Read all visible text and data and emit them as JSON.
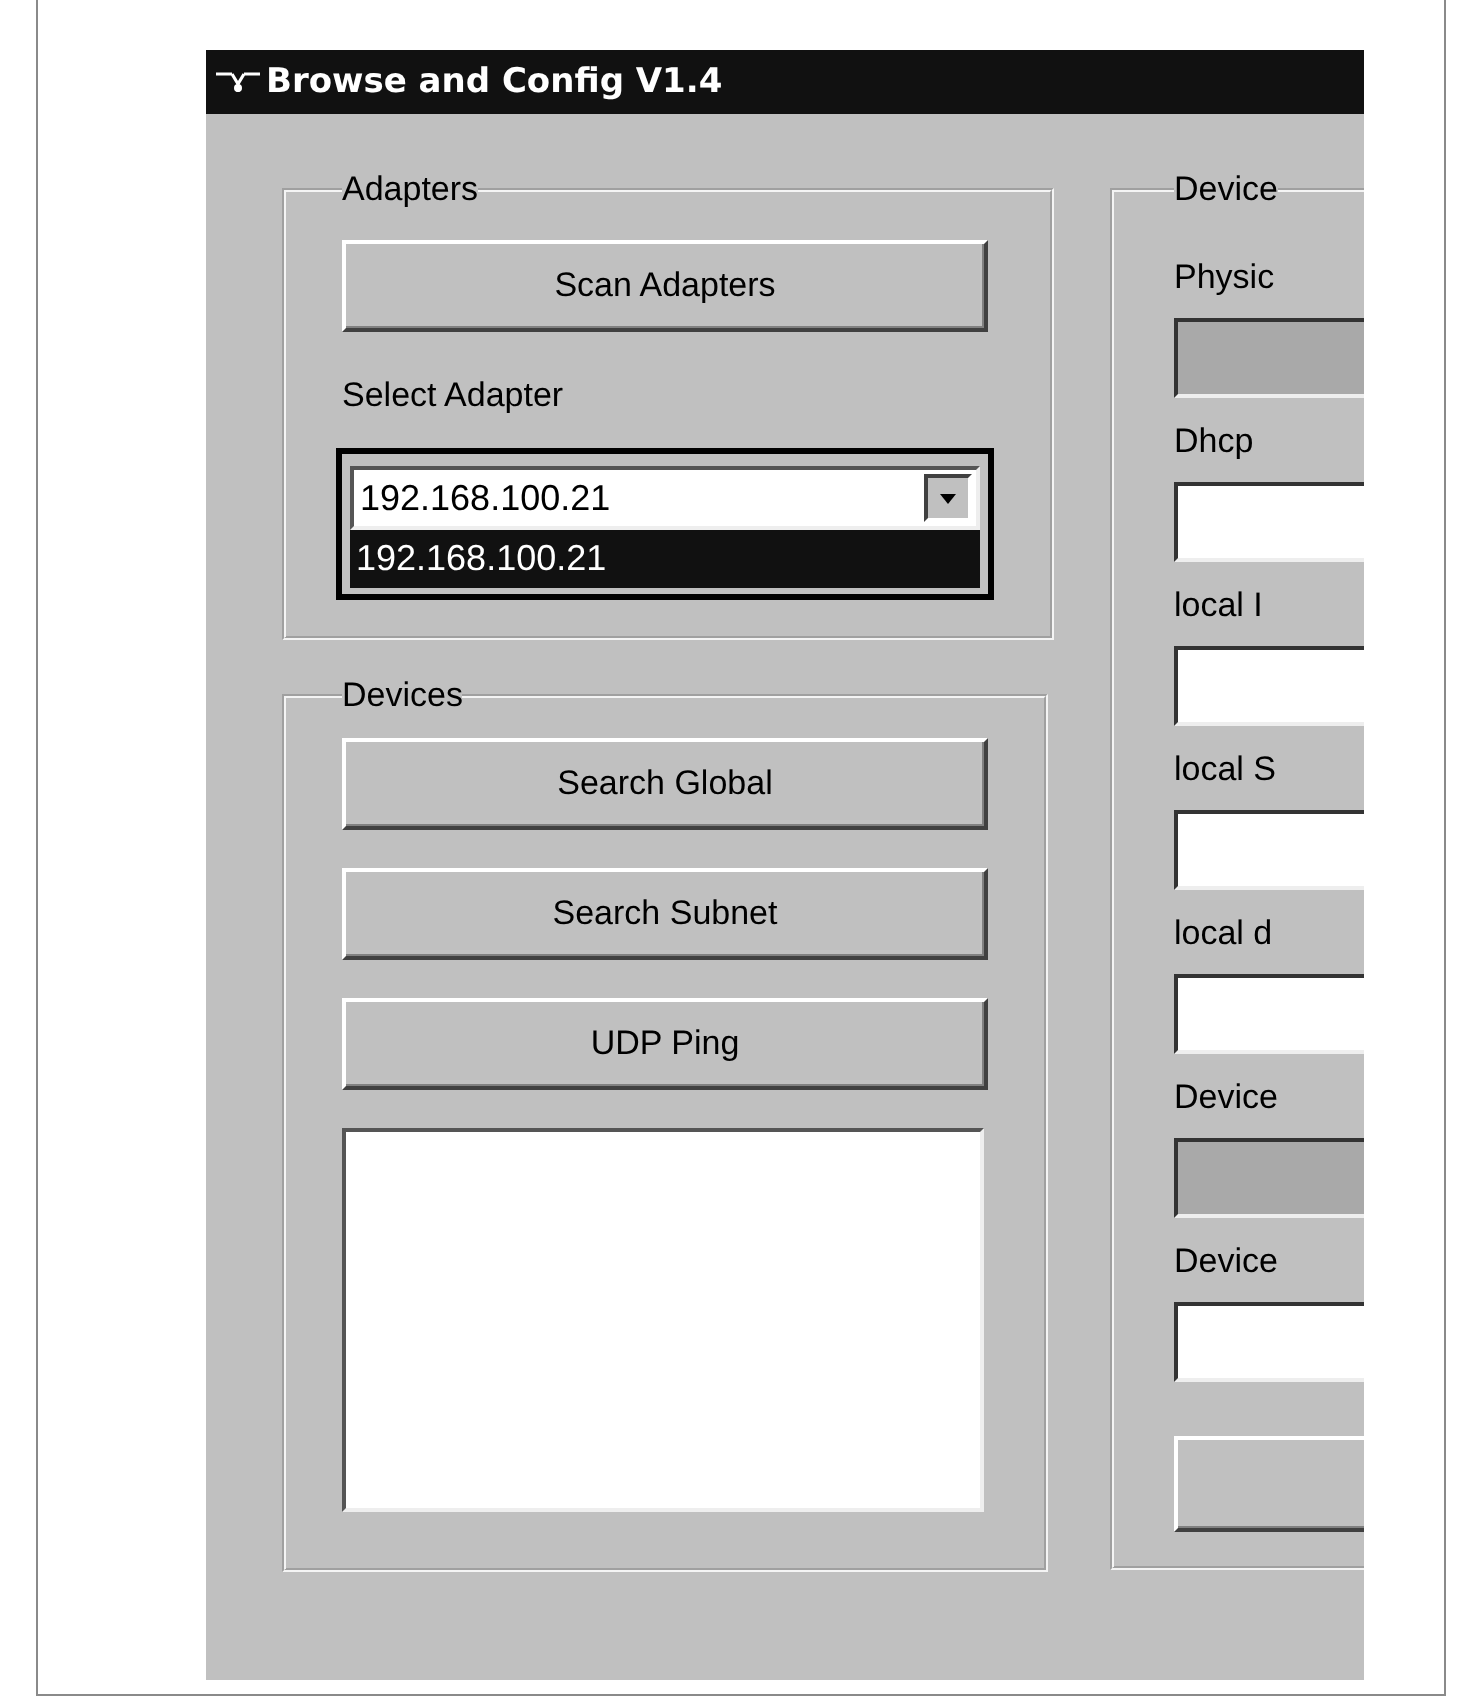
{
  "window": {
    "title": "Browse and Config V1.4"
  },
  "adapters": {
    "label": "Adapters",
    "scan_button": "Scan Adapters",
    "select_label": "Select Adapter",
    "combo": {
      "value": "192.168.100.21",
      "expanded": true,
      "options": [
        {
          "label": "192.168.100.21",
          "selected": true
        }
      ]
    }
  },
  "devices": {
    "label": "Devices",
    "buttons": [
      "Search Global",
      "Search Subnet",
      "UDP Ping"
    ]
  },
  "device_panel": {
    "label": "Device",
    "fields": [
      {
        "label": "Physic",
        "disabled": true
      },
      {
        "label": "Dhcp",
        "disabled": false
      },
      {
        "label": "local I",
        "disabled": false
      },
      {
        "label": "local S",
        "disabled": false
      },
      {
        "label": "local d",
        "disabled": false
      },
      {
        "label": "Device",
        "disabled": true
      },
      {
        "label": "Device",
        "disabled": false
      }
    ]
  }
}
